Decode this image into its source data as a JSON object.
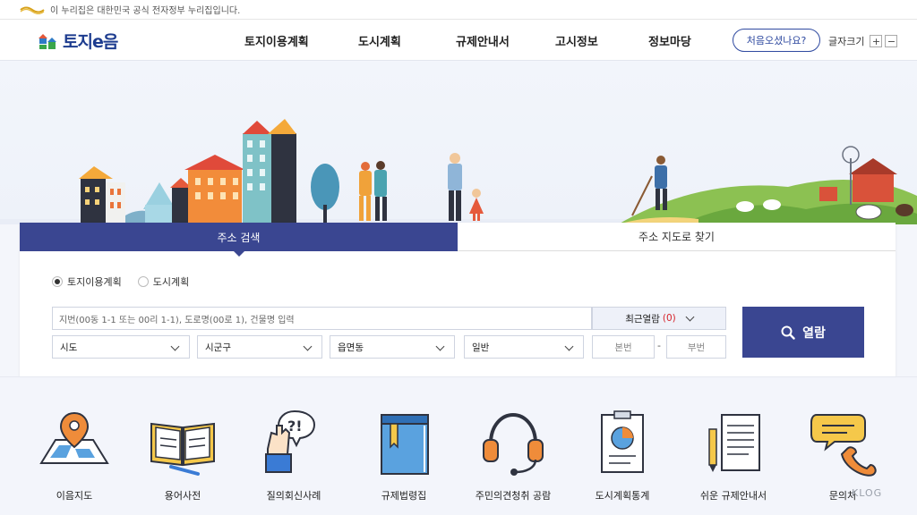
{
  "gov_banner": {
    "text": "이 누리집은 대한민국 공식 전자정부 누리집입니다."
  },
  "header": {
    "brand": "토지e음",
    "nav": [
      "토지이용계획",
      "도시계획",
      "규제안내서",
      "고시정보",
      "정보마당"
    ],
    "first_visit": "처음오셨나요?",
    "font_size_label": "글자크기",
    "font_plus": "+",
    "font_minus": "−"
  },
  "search": {
    "tabs": [
      {
        "label": "주소 검색",
        "active": true
      },
      {
        "label": "주소 지도로 찾기",
        "active": false
      }
    ],
    "radios": [
      {
        "label": "토지이용계획",
        "checked": true
      },
      {
        "label": "도시계획",
        "checked": false
      }
    ],
    "address_placeholder": "지번(00동 1-1 또는 00리 1-1), 도로명(00로 1), 건물명 입력",
    "recent_label": "최근열람",
    "recent_count": "(0)",
    "selects": [
      "시도",
      "시군구",
      "읍면동",
      "일반"
    ],
    "main_no": "본번",
    "dash": "-",
    "sub_no": "부번",
    "submit": "열람"
  },
  "quick_menu": [
    {
      "label": "이음지도",
      "icon": "map-pin-icon"
    },
    {
      "label": "용어사전",
      "icon": "open-book-icon"
    },
    {
      "label": "질의회신사례",
      "icon": "question-hand-icon"
    },
    {
      "label": "규제법령집",
      "icon": "law-book-icon"
    },
    {
      "label": "주민의견청취 공람",
      "icon": "headset-icon"
    },
    {
      "label": "도시계획통계",
      "icon": "chart-board-icon"
    },
    {
      "label": "쉬운 규제안내서",
      "icon": "document-pencil-icon"
    },
    {
      "label": "문의처",
      "icon": "phone-chat-icon"
    }
  ],
  "watermark": "KLOG",
  "colors": {
    "primary": "#3a4691",
    "brand_blue": "#1d3c8f",
    "recent_count": "#d6232b"
  }
}
